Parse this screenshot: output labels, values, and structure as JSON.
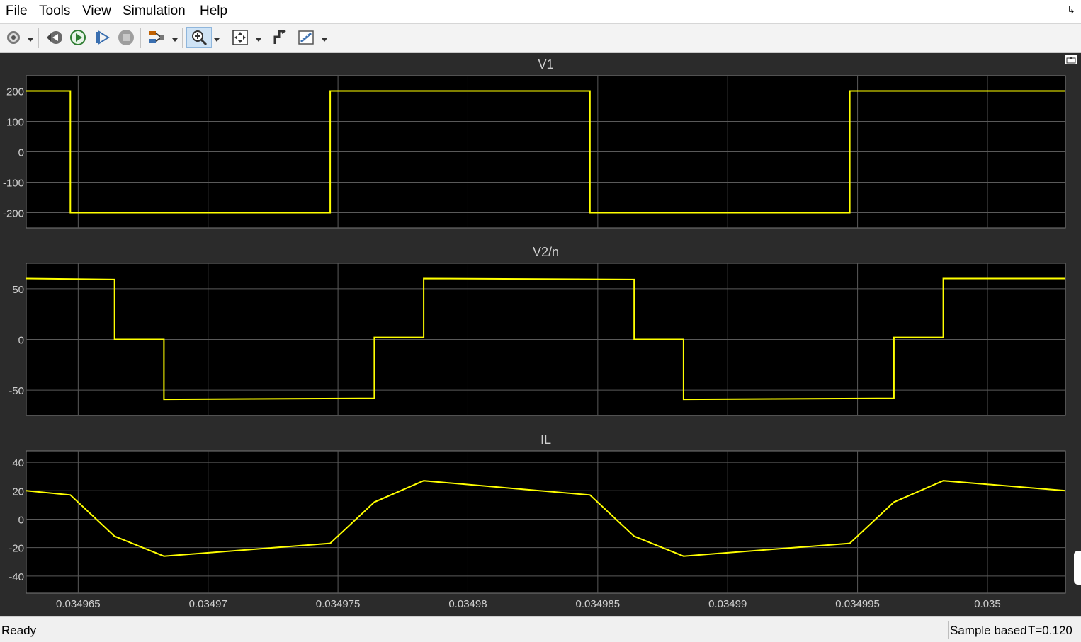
{
  "menubar": {
    "items": [
      "File",
      "Tools",
      "View",
      "Simulation",
      "Help"
    ]
  },
  "toolbar": {
    "buttons": [
      {
        "icon": "settings-gear-icon",
        "dropdown": true
      },
      {
        "icon": "step-back-icon"
      },
      {
        "icon": "run-icon"
      },
      {
        "icon": "step-forward-icon"
      },
      {
        "icon": "stop-icon"
      },
      {
        "icon": "signal-selector-icon",
        "dropdown": true
      },
      {
        "icon": "zoom-in-icon",
        "dropdown": true,
        "active": true
      },
      {
        "icon": "fit-to-view-icon",
        "dropdown": true
      },
      {
        "icon": "triggers-icon"
      },
      {
        "icon": "measurements-icon",
        "dropdown": true
      }
    ]
  },
  "colors": {
    "trace": "#ffff00",
    "axes_background": "#000000",
    "figure_background": "#2b2b2b",
    "grid": "#5a5a5a",
    "text": "#d0d0d0"
  },
  "chart_data": [
    {
      "type": "line",
      "title": "V1",
      "xlim": [
        0.034963,
        0.035003
      ],
      "ylim": [
        -250,
        250
      ],
      "yticks": [
        "200",
        "100",
        "0",
        "-100",
        "-200"
      ],
      "ytick_values": [
        200,
        100,
        0,
        -100,
        -200
      ],
      "grid": true,
      "series": [
        {
          "x": [
            0.034963,
            0.0349647,
            0.0349647,
            0.0349747,
            0.0349747,
            0.0349847,
            0.0349847,
            0.0349947,
            0.0349947,
            0.035003
          ],
          "y": [
            200,
            200,
            -200,
            -200,
            200,
            200,
            -200,
            -200,
            200,
            200
          ]
        }
      ]
    },
    {
      "type": "line",
      "title": "V2/n",
      "xlim": [
        0.034963,
        0.035003
      ],
      "ylim": [
        -75,
        75
      ],
      "yticks": [
        "50",
        "0",
        "-50"
      ],
      "ytick_values": [
        50,
        0,
        -50
      ],
      "grid": true,
      "series": [
        {
          "x": [
            0.034963,
            0.0349664,
            0.0349664,
            0.0349683,
            0.0349683,
            0.0349764,
            0.0349764,
            0.0349783,
            0.0349783,
            0.0349864,
            0.0349864,
            0.0349883,
            0.0349883,
            0.0349964,
            0.0349964,
            0.0349983,
            0.0349983,
            0.035003
          ],
          "y": [
            60,
            59,
            0,
            0,
            -59,
            -58,
            2,
            2,
            60,
            59,
            0,
            0,
            -59,
            -58,
            2,
            2,
            60,
            60
          ]
        }
      ]
    },
    {
      "type": "line",
      "title": "IL",
      "xlim": [
        0.034963,
        0.035003
      ],
      "ylim": [
        -52,
        48
      ],
      "yticks": [
        "40",
        "20",
        "0",
        "-20",
        "-40"
      ],
      "ytick_values": [
        40,
        20,
        0,
        -20,
        -40
      ],
      "xticks": [
        "0.034965",
        "0.03497",
        "0.034975",
        "0.03498",
        "0.034985",
        "0.03499",
        "0.034995",
        "0.035"
      ],
      "xtick_values": [
        0.034965,
        0.03497,
        0.034975,
        0.03498,
        0.034985,
        0.03499,
        0.034995,
        0.035
      ],
      "grid": true,
      "series": [
        {
          "x": [
            0.034963,
            0.0349647,
            0.0349664,
            0.0349683,
            0.0349747,
            0.0349764,
            0.0349783,
            0.0349847,
            0.0349864,
            0.0349883,
            0.0349947,
            0.0349964,
            0.0349983,
            0.035003
          ],
          "y": [
            20,
            17,
            -12,
            -26,
            -17,
            12,
            27,
            17,
            -12,
            -26,
            -17,
            12,
            27,
            20
          ]
        }
      ]
    }
  ],
  "statusbar": {
    "ready": "Ready",
    "sample": "Sample based",
    "time": "T=0.120"
  }
}
